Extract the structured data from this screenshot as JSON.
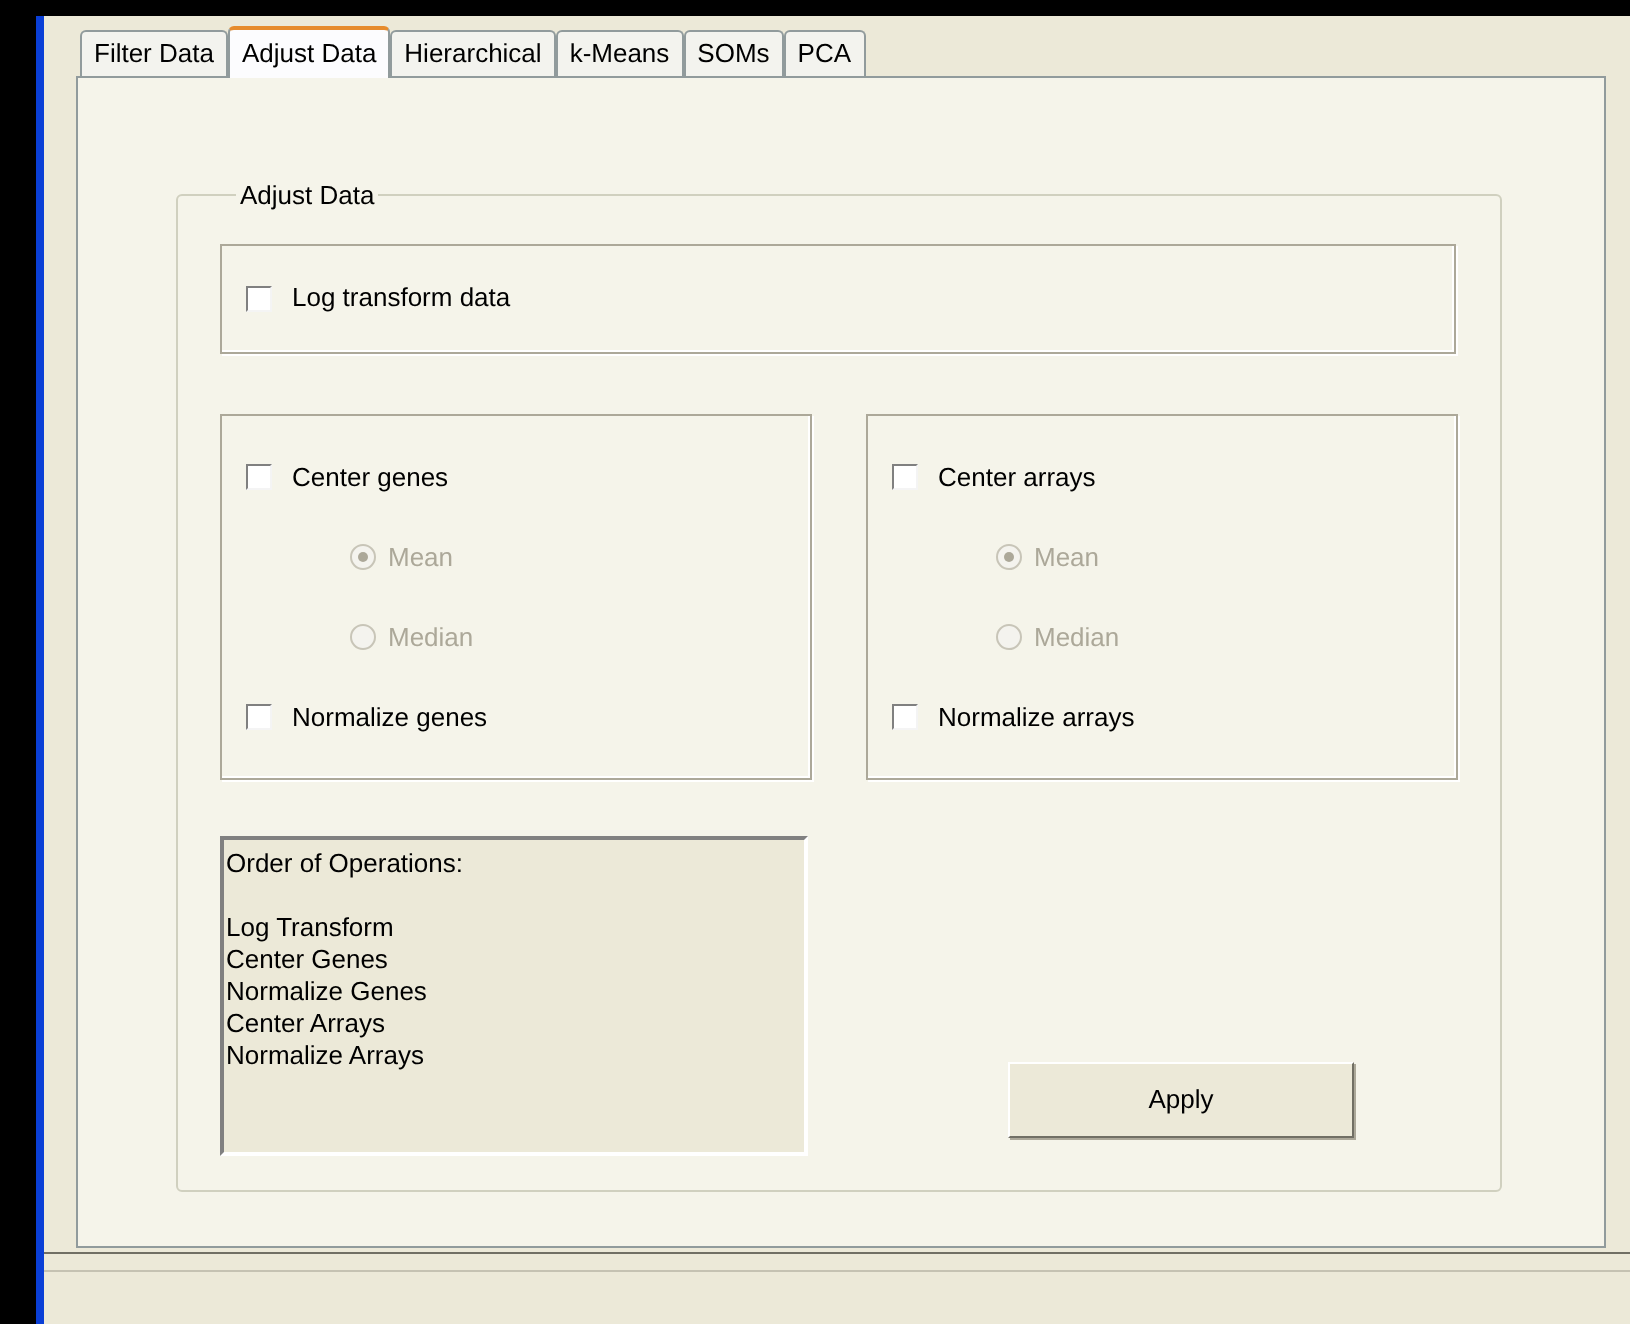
{
  "tabs": [
    {
      "label": "Filter Data",
      "selected": false
    },
    {
      "label": "Adjust Data",
      "selected": true
    },
    {
      "label": "Hierarchical",
      "selected": false
    },
    {
      "label": "k-Means",
      "selected": false
    },
    {
      "label": "SOMs",
      "selected": false
    },
    {
      "label": "PCA",
      "selected": false
    }
  ],
  "group_title": "Adjust Data",
  "log_transform": {
    "label": "Log transform data",
    "checked": false
  },
  "center_groups": [
    {
      "center": {
        "label": "Center genes",
        "checked": false
      },
      "methods": [
        {
          "label": "Mean",
          "selected": true,
          "disabled": true
        },
        {
          "label": "Median",
          "selected": false,
          "disabled": true
        }
      ],
      "normalize": {
        "label": "Normalize genes",
        "checked": false
      }
    },
    {
      "center": {
        "label": "Center arrays",
        "checked": false
      },
      "methods": [
        {
          "label": "Mean",
          "selected": true,
          "disabled": true
        },
        {
          "label": "Median",
          "selected": false,
          "disabled": true
        }
      ],
      "normalize": {
        "label": "Normalize arrays",
        "checked": false
      }
    }
  ],
  "order_of_operations": {
    "heading": "Order of Operations:",
    "lines": [
      "Log Transform",
      "Center Genes",
      "Normalize Genes",
      "Center Arrays",
      "Normalize Arrays"
    ]
  },
  "apply_button": "Apply"
}
